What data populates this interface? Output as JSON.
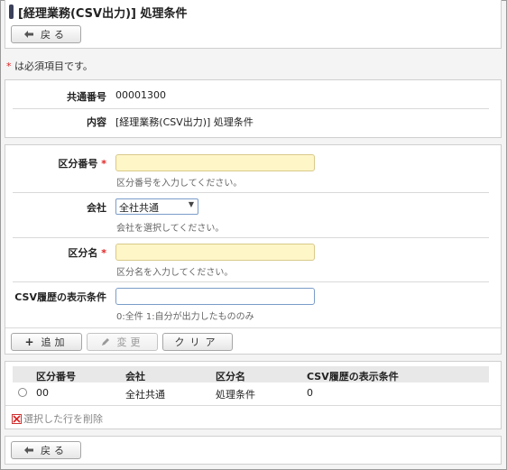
{
  "page": {
    "title": "[経理業務(CSV出力)] 処理条件",
    "back_label": "戻る",
    "required_note_star": "*",
    "required_note_text": " は必須項目です。"
  },
  "info": {
    "common_no_label": "共通番号",
    "common_no_value": "00001300",
    "content_label": "内容",
    "content_value": "[経理業務(CSV出力)] 処理条件"
  },
  "form": {
    "kubun_no_label": "区分番号",
    "kubun_no_value": "",
    "kubun_no_hint": "区分番号を入力してください。",
    "company_label": "会社",
    "company_value": "全社共通",
    "company_hint": "会社を選択してください。",
    "kubun_name_label": "区分名",
    "kubun_name_value": "",
    "kubun_name_hint": "区分名を入力してください。",
    "csv_cond_label": "CSV履歴の表示条件",
    "csv_cond_value": "",
    "csv_cond_hint": "0:全件 1:自分が出力したもののみ",
    "required_star": "*"
  },
  "actions": {
    "add_label": "追加",
    "edit_label": "変更",
    "clear_label": "クリア"
  },
  "table": {
    "headers": [
      "区分番号",
      "会社",
      "区分名",
      "CSV履歴の表示条件"
    ],
    "rows": [
      [
        "00",
        "全社共通",
        "処理条件",
        "0"
      ]
    ],
    "delete_label": "選択した行を削除"
  }
}
